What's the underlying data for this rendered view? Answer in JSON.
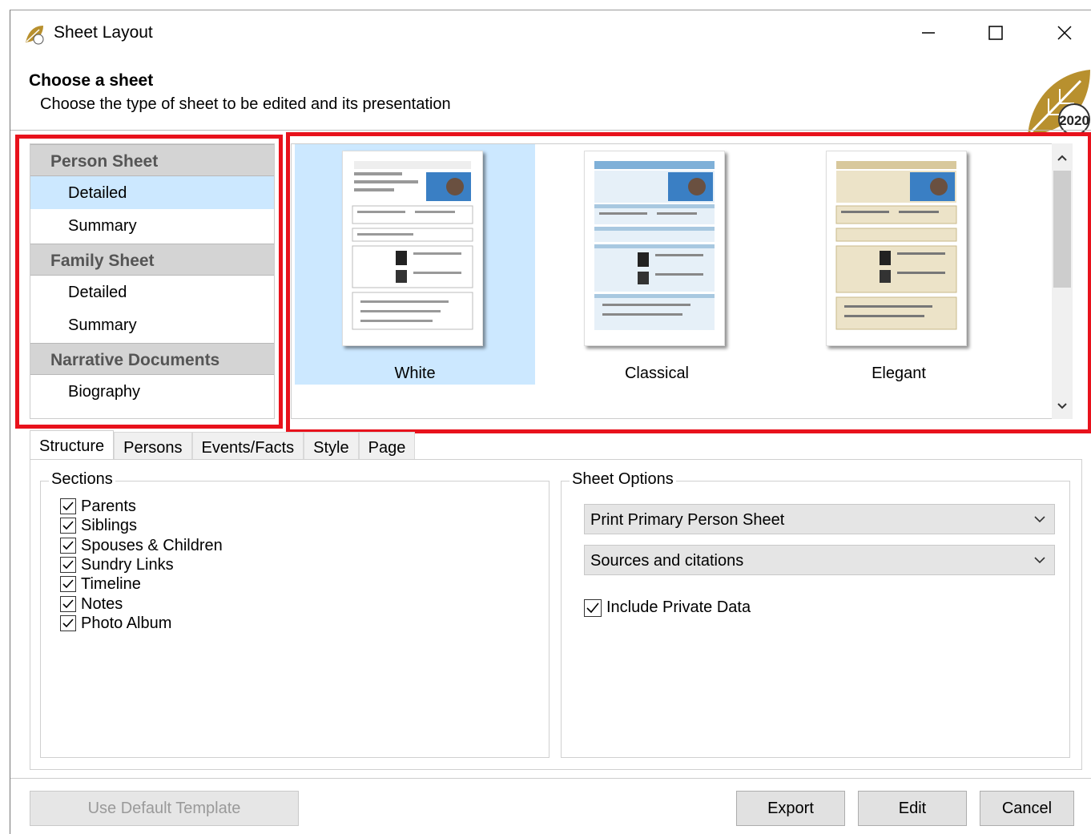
{
  "window": {
    "title": "Sheet Layout"
  },
  "header": {
    "title": "Choose a sheet",
    "subtitle": "Choose the type of sheet to be edited and its presentation",
    "logo_text": "2020"
  },
  "sheet_list": {
    "groups": [
      {
        "label": "Person Sheet",
        "items": [
          {
            "label": "Detailed",
            "selected": true
          },
          {
            "label": "Summary",
            "selected": false
          }
        ]
      },
      {
        "label": "Family Sheet",
        "items": [
          {
            "label": "Detailed",
            "selected": false
          },
          {
            "label": "Summary",
            "selected": false
          }
        ]
      },
      {
        "label": "Narrative Documents",
        "items": [
          {
            "label": "Biography",
            "selected": false
          }
        ]
      }
    ]
  },
  "presentations": [
    {
      "label": "White",
      "selected": true,
      "theme": "#ffffff"
    },
    {
      "label": "Classical",
      "selected": false,
      "theme": "#a8c8e0"
    },
    {
      "label": "Elegant",
      "selected": false,
      "theme": "#ece3c8"
    }
  ],
  "tabs": [
    {
      "label": "Structure",
      "active": true
    },
    {
      "label": "Persons",
      "active": false
    },
    {
      "label": "Events/Facts",
      "active": false
    },
    {
      "label": "Style",
      "active": false
    },
    {
      "label": "Page",
      "active": false
    }
  ],
  "structure": {
    "sections_legend": "Sections",
    "sections": [
      {
        "label": "Parents",
        "checked": true
      },
      {
        "label": "Siblings",
        "checked": true
      },
      {
        "label": "Spouses & Children",
        "checked": true
      },
      {
        "label": "Sundry Links",
        "checked": true
      },
      {
        "label": "Timeline",
        "checked": true
      },
      {
        "label": "Notes",
        "checked": true
      },
      {
        "label": "Photo Album",
        "checked": true
      }
    ],
    "options_legend": "Sheet Options",
    "print_mode": "Print Primary Person Sheet",
    "sources_mode": "Sources and citations",
    "include_private_label": "Include Private Data",
    "include_private_checked": true
  },
  "buttons": {
    "default_template": "Use Default Template",
    "export": "Export",
    "edit": "Edit",
    "cancel": "Cancel"
  },
  "colors": {
    "selection": "#cce8ff",
    "highlight_border": "#e8121c",
    "logo_gold": "#b8902e"
  }
}
